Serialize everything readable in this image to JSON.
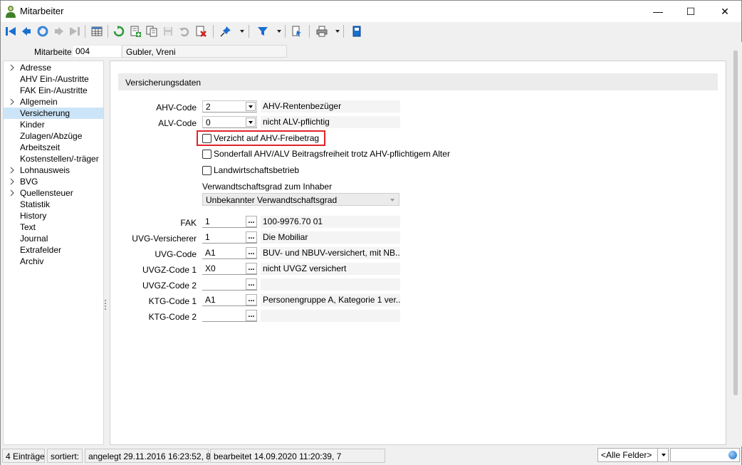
{
  "window": {
    "title": "Mitarbeiter",
    "icon": "person-icon"
  },
  "window_controls": {
    "minimize": "—",
    "maximize": "☐",
    "close": "✕"
  },
  "toolbar": {
    "icons": [
      "first-record-icon",
      "prev-record-icon",
      "undo-icon",
      "next-record-icon",
      "last-record-icon",
      "table-view-icon",
      "refresh-icon",
      "new-record-icon",
      "copy-record-icon",
      "save-icon",
      "revert-icon",
      "delete-icon",
      "pin-icon",
      "filter-icon",
      "export-icon",
      "print-icon",
      "bookmark-icon"
    ]
  },
  "header": {
    "label": "Mitarbeiter",
    "number": "004",
    "name": "Gubler, Vreni"
  },
  "sidebar": {
    "items": [
      {
        "label": "Adresse",
        "expandable": true
      },
      {
        "label": "AHV Ein-/Austritte",
        "expandable": false
      },
      {
        "label": "FAK Ein-/Austritte",
        "expandable": false
      },
      {
        "label": "Allgemein",
        "expandable": true
      },
      {
        "label": "Versicherung",
        "expandable": false,
        "selected": true
      },
      {
        "label": "Kinder",
        "expandable": false
      },
      {
        "label": "Zulagen/Abzüge",
        "expandable": false
      },
      {
        "label": "Arbeitszeit",
        "expandable": false
      },
      {
        "label": "Kostenstellen/-träger",
        "expandable": false
      },
      {
        "label": "Lohnausweis",
        "expandable": true
      },
      {
        "label": "BVG",
        "expandable": true
      },
      {
        "label": "Quellensteuer",
        "expandable": true
      },
      {
        "label": "Statistik",
        "expandable": false
      },
      {
        "label": "History",
        "expandable": false
      },
      {
        "label": "Text",
        "expandable": false
      },
      {
        "label": "Journal",
        "expandable": false
      },
      {
        "label": "Extrafelder",
        "expandable": false
      },
      {
        "label": "Archiv",
        "expandable": false
      }
    ]
  },
  "main": {
    "section_title": "Versicherungsdaten",
    "ahv_code": {
      "label": "AHV-Code",
      "value": "2",
      "desc": "AHV-Rentenbezüger"
    },
    "alv_code": {
      "label": "ALV-Code",
      "value": "0",
      "desc": "nicht ALV-pflichtig"
    },
    "checkboxes": [
      {
        "label": "Verzicht auf AHV-Freibetrag",
        "checked": false
      },
      {
        "label": "Sonderfall AHV/ALV Beitragsfreiheit trotz AHV-pflichtigem Alter",
        "checked": false
      },
      {
        "label": "Landwirtschaftsbetrieb",
        "checked": false
      }
    ],
    "relation": {
      "label": "Verwandtschaftsgrad zum Inhaber",
      "value": "Unbekannter Verwandtschaftsgrad"
    },
    "fields": [
      {
        "label": "FAK",
        "value": "1",
        "desc": "100-9976.70  01"
      },
      {
        "label": "UVG-Versicherer",
        "value": "1",
        "desc": "Die Mobiliar"
      },
      {
        "label": "UVG-Code",
        "value": "A1",
        "desc": "BUV- und NBUV-versichert, mit NB..."
      },
      {
        "label": "UVGZ-Code 1",
        "value": "X0",
        "desc": "nicht UVGZ versichert"
      },
      {
        "label": "UVGZ-Code 2",
        "value": "",
        "desc": ""
      },
      {
        "label": "KTG-Code 1",
        "value": "A1",
        "desc": "Personengruppe A, Kategorie 1 ver..."
      },
      {
        "label": "KTG-Code 2",
        "value": "",
        "desc": ""
      }
    ],
    "dots_label": "..."
  },
  "status": {
    "count": "4 Einträge",
    "sorted": "sortiert:",
    "created": "angelegt 29.11.2016 16:23:52,  8",
    "edited": "bearbeitet 14.09.2020 11:20:39,  7",
    "field_filter": "<Alle Felder>",
    "search_value": ""
  },
  "colors": {
    "selection": "#cce4f7",
    "highlight": "#e0242a",
    "accent": "#1a6fd0"
  }
}
